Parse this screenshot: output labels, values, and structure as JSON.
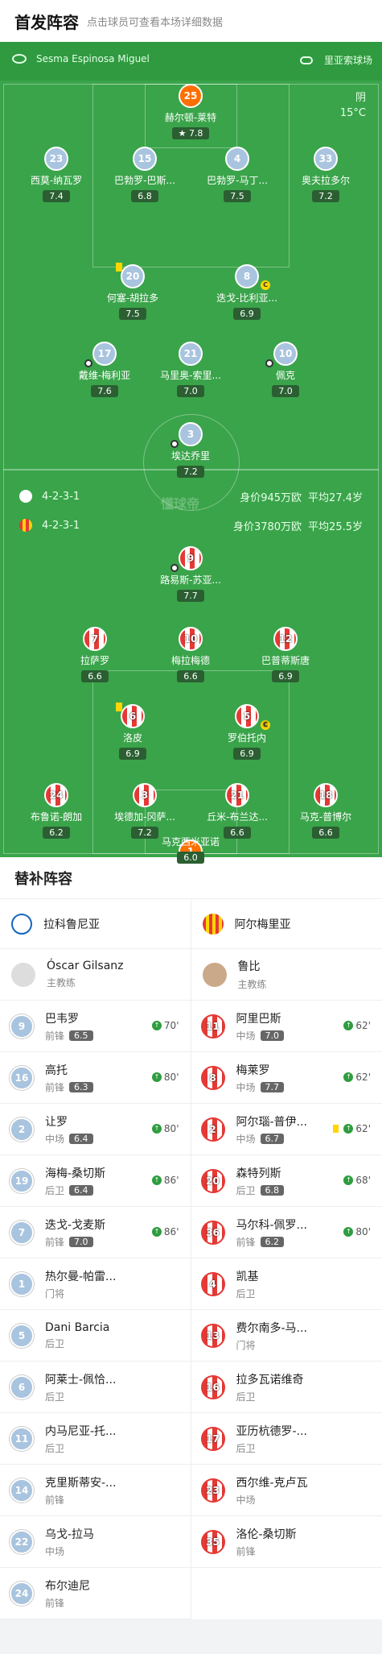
{
  "header": {
    "title": "首发阵容",
    "subtitle": "点击球员可查看本场详细数据"
  },
  "pitch": {
    "referee": "Sesma Espinosa Miguel",
    "venue": "里亚索球场",
    "weather": "阴",
    "temperature": "15°C",
    "home_formation": "4-2-3-1",
    "away_formation": "4-2-3-1",
    "home_value": "身价945万欧",
    "home_avg_age": "平均27.4岁",
    "away_value": "身价3780万欧",
    "away_avg_age": "平均25.5岁",
    "watermark": "懂球帝",
    "home_players": [
      {
        "num": "25",
        "name": "赫尔顿-莱特",
        "rating": "7.8"
      },
      {
        "num": "23",
        "name": "西莫-纳瓦罗",
        "rating": "7.4"
      },
      {
        "num": "15",
        "name": "巴勃罗-巴斯...",
        "rating": "6.8"
      },
      {
        "num": "4",
        "name": "巴勃罗-马丁...",
        "rating": "7.5"
      },
      {
        "num": "33",
        "name": "奥夫拉多尔",
        "rating": "7.2"
      },
      {
        "num": "20",
        "name": "何塞-胡拉多",
        "rating": "7.5"
      },
      {
        "num": "8",
        "name": "迭戈-比利亚...",
        "rating": "6.9",
        "sub": "86'"
      },
      {
        "num": "17",
        "name": "戴维-梅利亚",
        "rating": "7.6",
        "sub": "80'"
      },
      {
        "num": "21",
        "name": "马里奥-索里...",
        "rating": "7.0",
        "sub": "80'"
      },
      {
        "num": "10",
        "name": "佩克",
        "rating": "7.0",
        "sub": "86'"
      },
      {
        "num": "3",
        "name": "埃达乔里",
        "rating": "7.2",
        "sub": "70'"
      }
    ],
    "away_players": [
      {
        "num": "9",
        "name": "路易斯-苏亚...",
        "rating": "7.7"
      },
      {
        "num": "7",
        "name": "拉萨罗",
        "rating": "6.6",
        "sub": "80'"
      },
      {
        "num": "10",
        "name": "梅拉梅德",
        "rating": "6.6",
        "sub": "62'"
      },
      {
        "num": "12",
        "name": "巴普蒂斯唐",
        "rating": "6.9",
        "sub": "62'"
      },
      {
        "num": "6",
        "name": "洛皮",
        "rating": "6.9"
      },
      {
        "num": "5",
        "name": "罗伯托内",
        "rating": "6.9",
        "sub": "62'"
      },
      {
        "num": "24",
        "name": "布鲁诺-朗加",
        "rating": "6.2",
        "sub": "68'"
      },
      {
        "num": "3",
        "name": "埃德加-冈萨...",
        "rating": "7.2"
      },
      {
        "num": "21",
        "name": "丘米-布兰达...",
        "rating": "6.6"
      },
      {
        "num": "18",
        "name": "马克-普博尔",
        "rating": "6.6"
      },
      {
        "num": "1",
        "name": "马克西米亚诺",
        "rating": "6.0"
      }
    ]
  },
  "subs": {
    "title": "替补阵容",
    "home_team": "拉科鲁尼亚",
    "away_team": "阿尔梅里亚",
    "home_coach": {
      "name": "Óscar Gilsanz",
      "role": "主教练"
    },
    "away_coach": {
      "name": "鲁比",
      "role": "主教练"
    },
    "home": [
      {
        "num": "9",
        "name": "巴韦罗",
        "pos": "前锋",
        "rating": "6.5",
        "time": "70'"
      },
      {
        "num": "16",
        "name": "高托",
        "pos": "前锋",
        "rating": "6.3",
        "time": "80'"
      },
      {
        "num": "2",
        "name": "让罗",
        "pos": "中场",
        "rating": "6.4",
        "time": "80'"
      },
      {
        "num": "19",
        "name": "海梅-桑切斯",
        "pos": "后卫",
        "rating": "6.4",
        "time": "86'"
      },
      {
        "num": "7",
        "name": "迭戈-戈麦斯",
        "pos": "前锋",
        "rating": "7.0",
        "time": "86'"
      },
      {
        "num": "1",
        "name": "热尔曼-帕雷...",
        "pos": "门将"
      },
      {
        "num": "5",
        "name": "Dani Barcia",
        "pos": "后卫"
      },
      {
        "num": "6",
        "name": "阿莱士-佩恰...",
        "pos": "后卫"
      },
      {
        "num": "11",
        "name": "内马尼亚-托...",
        "pos": "后卫"
      },
      {
        "num": "14",
        "name": "克里斯蒂安-...",
        "pos": "前锋"
      },
      {
        "num": "22",
        "name": "乌戈-拉马",
        "pos": "中场"
      },
      {
        "num": "24",
        "name": "布尔迪尼",
        "pos": "前锋"
      }
    ],
    "away": [
      {
        "num": "11",
        "name": "阿里巴斯",
        "pos": "中场",
        "rating": "7.0",
        "time": "62'"
      },
      {
        "num": "8",
        "name": "梅莱罗",
        "pos": "中场",
        "rating": "7.7",
        "time": "62'"
      },
      {
        "num": "2",
        "name": "阿尔瑙-普伊...",
        "pos": "中场",
        "rating": "6.7",
        "time": "62'"
      },
      {
        "num": "20",
        "name": "森特列斯",
        "pos": "后卫",
        "rating": "6.8",
        "time": "68'"
      },
      {
        "num": "36",
        "name": "马尔科-佩罗...",
        "pos": "前锋",
        "rating": "6.2",
        "time": "80'"
      },
      {
        "num": "4",
        "name": "凯基",
        "pos": "后卫"
      },
      {
        "num": "13",
        "name": "费尔南多-马...",
        "pos": "门将"
      },
      {
        "num": "16",
        "name": "拉多瓦诺维奇",
        "pos": "后卫"
      },
      {
        "num": "17",
        "name": "亚历杭德罗-...",
        "pos": "后卫"
      },
      {
        "num": "23",
        "name": "西尔维-克卢瓦",
        "pos": "中场"
      },
      {
        "num": "35",
        "name": "洛伦-桑切斯",
        "pos": "前锋"
      }
    ]
  }
}
